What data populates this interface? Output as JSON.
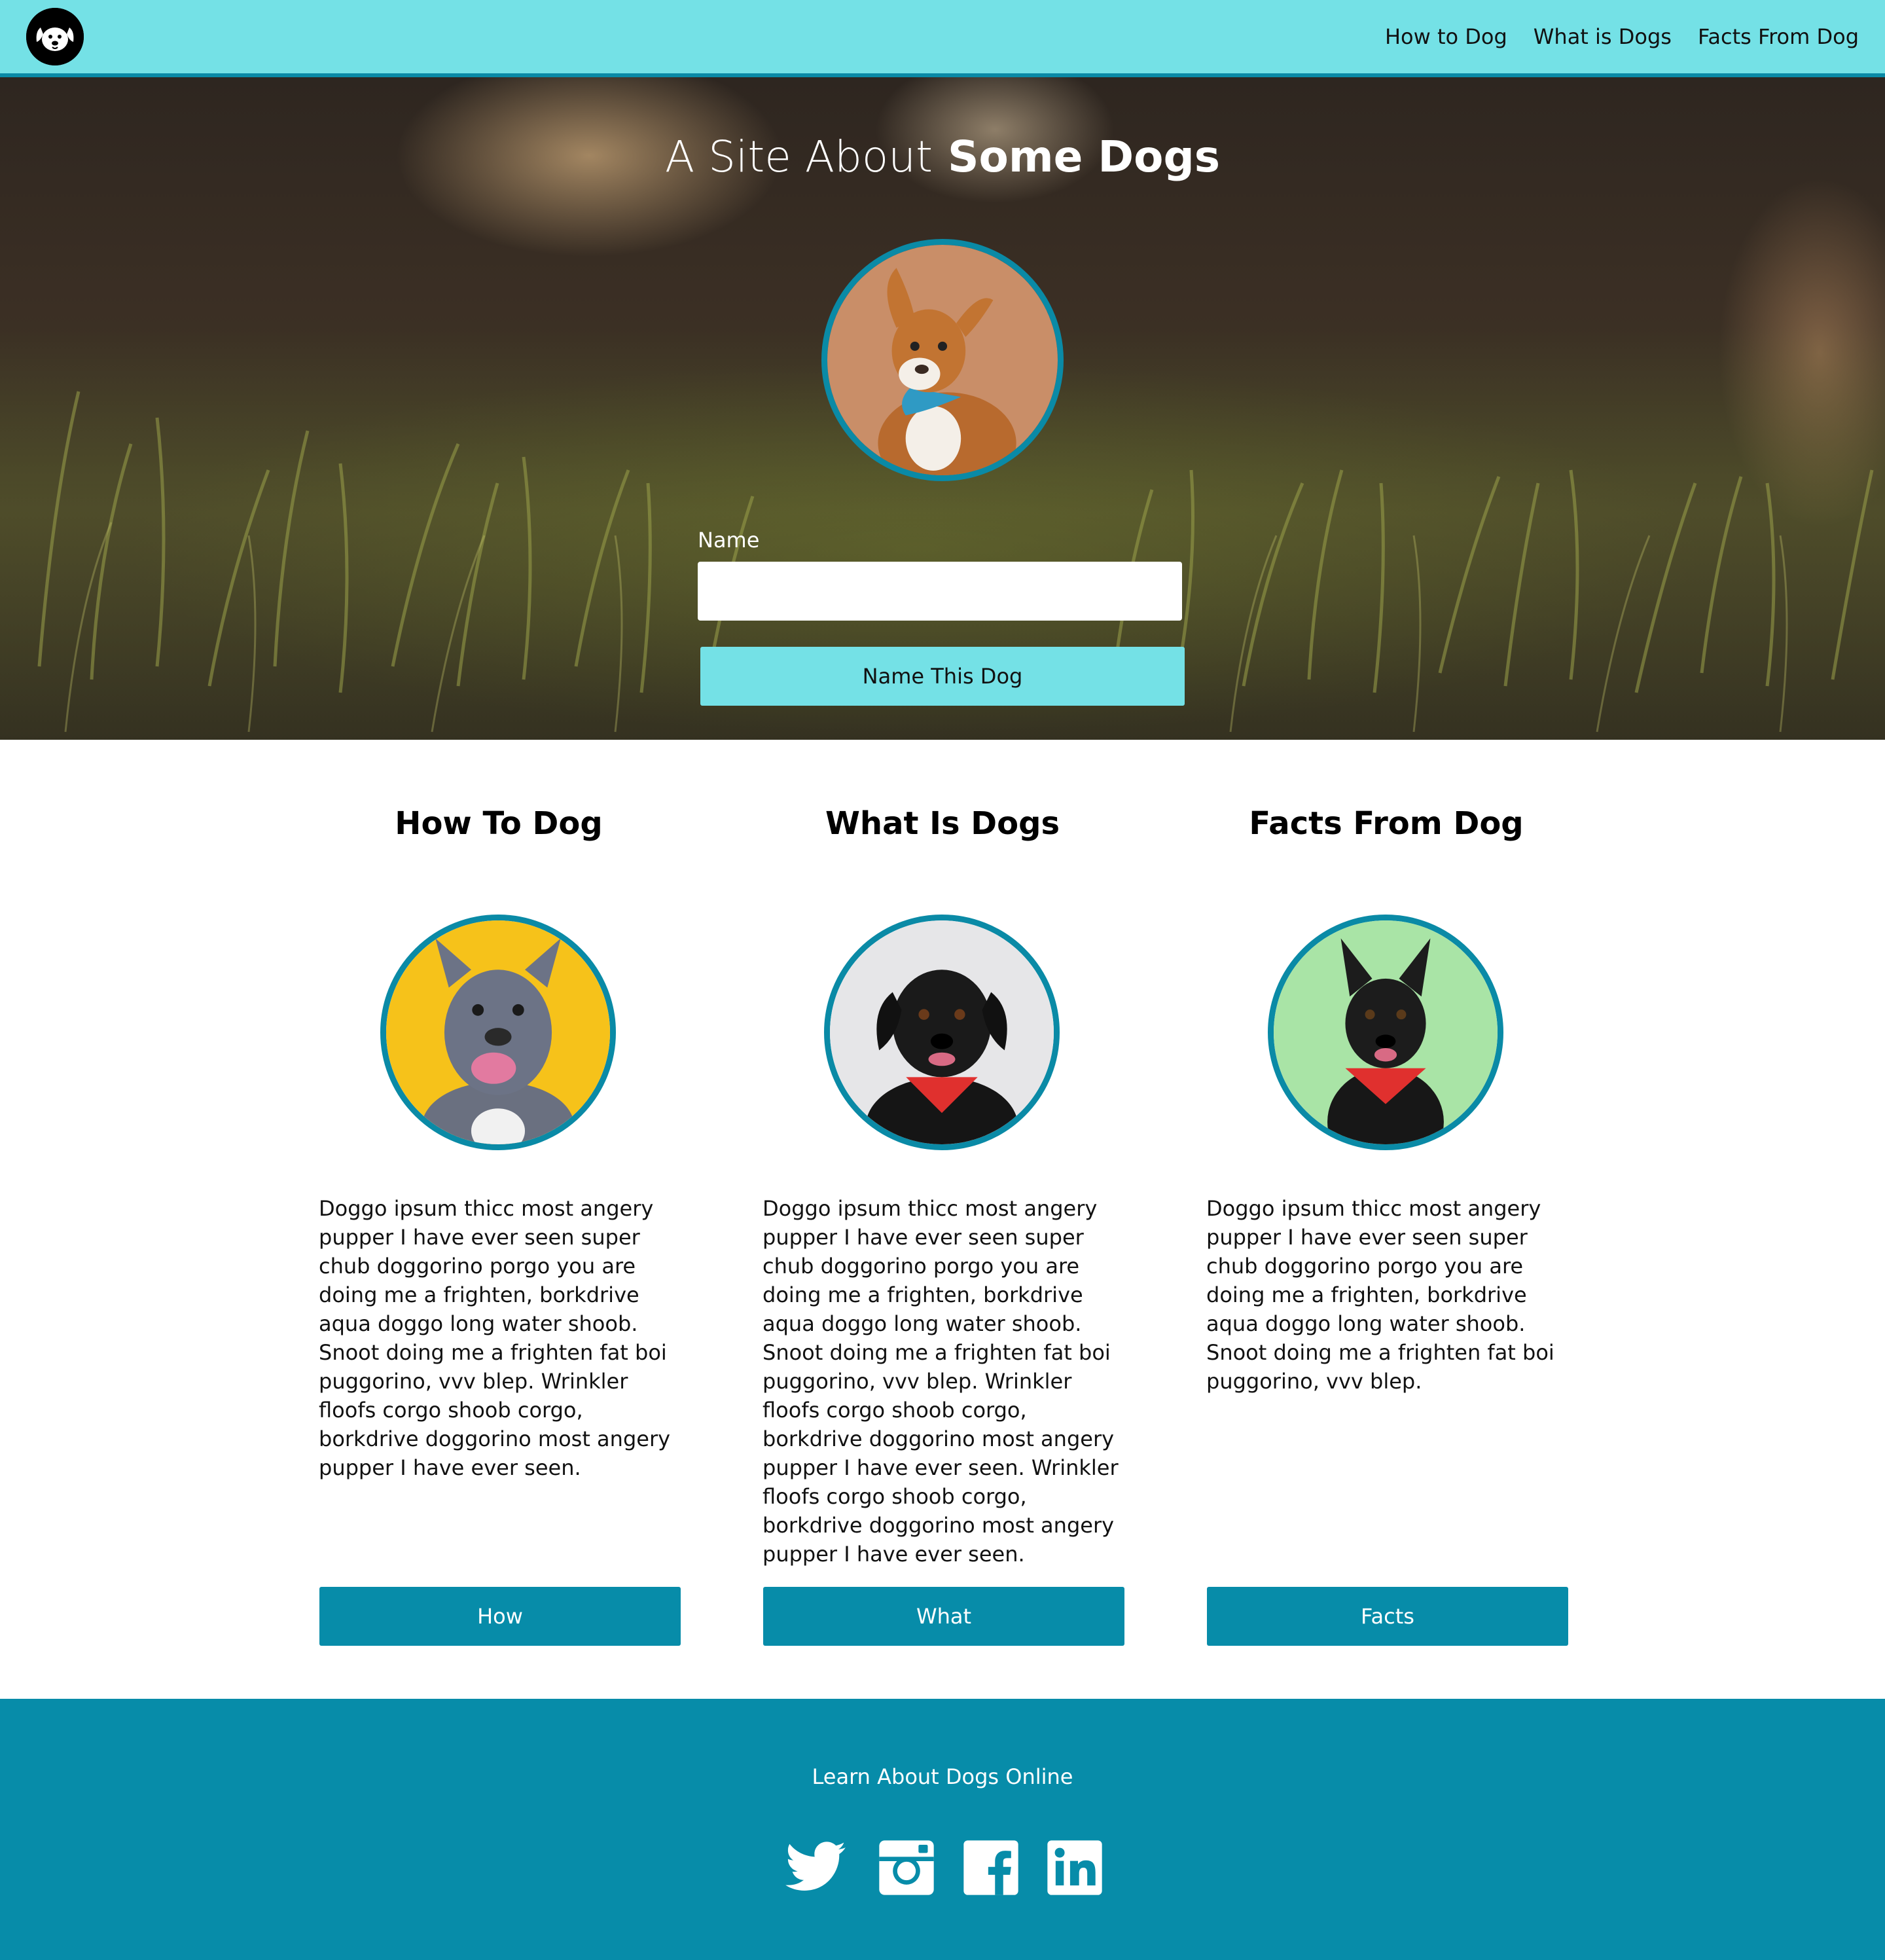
{
  "nav": {
    "logo_icon": "dog-face-icon",
    "links": [
      "How to Dog",
      "What is Dogs",
      "Facts From Dog"
    ]
  },
  "hero": {
    "title_light": "A Site About",
    "title_bold": "Some Dogs",
    "avatar_icon": "dog-photo",
    "name_label": "Name",
    "name_value": "",
    "name_placeholder": "",
    "button_label": "Name This Dog"
  },
  "features": [
    {
      "title": "How To Dog",
      "text": "Doggo ipsum thicc most angery pupper I have ever seen super chub doggorino porgo you are doing me a frighten, borkdrive aqua doggo long water shoob. Snoot doing me a frighten fat boi puggorino, vvv blep. Wrinkler floofs corgo shoob corgo, borkdrive doggorino most angery pupper I have ever seen.",
      "button": "How"
    },
    {
      "title": "What Is Dogs",
      "text": "Doggo ipsum thicc most angery pupper I have ever seen super chub doggorino porgo you are doing me a frighten, borkdrive aqua doggo long water shoob. Snoot doing me a frighten fat boi puggorino, vvv blep. Wrinkler floofs corgo shoob corgo, borkdrive doggorino most angery pupper I have ever seen. Wrinkler floofs corgo shoob corgo, borkdrive doggorino most angery pupper I have ever seen.",
      "button": "What"
    },
    {
      "title": "Facts From Dog",
      "text": "Doggo ipsum thicc most angery pupper I have ever seen super chub doggorino porgo you are doing me a frighten, borkdrive aqua doggo long water shoob. Snoot doing me a frighten fat boi puggorino, vvv blep.",
      "button": "Facts"
    }
  ],
  "footer": {
    "text": "Learn About Dogs Online",
    "social": [
      "twitter-icon",
      "instagram-icon",
      "facebook-icon",
      "linkedin-icon"
    ]
  },
  "colors": {
    "nav_bg": "#74e1e6",
    "accent": "#078ca9",
    "ring": "#0a8aa6",
    "footer_bg": "#078ca9"
  }
}
